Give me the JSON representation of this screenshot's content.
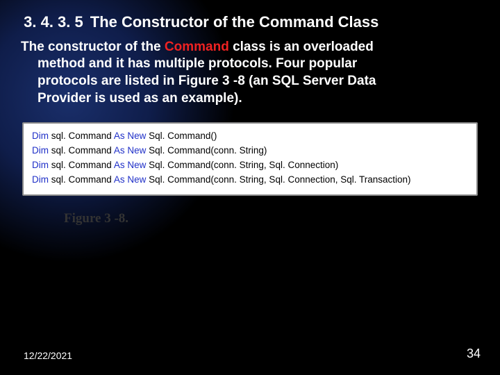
{
  "heading": {
    "number": "3. 4. 3. 5",
    "text": "The Constructor of the Command Class"
  },
  "paragraph": {
    "prefix": "The constructor of the ",
    "command_word": "Command",
    "rest1": " class is an overloaded",
    "rest2": "method and it has multiple protocols. Four popular",
    "rest3": "protocols are listed in Figure 3 -8 (an SQL Server Data",
    "rest4": "Provider is used as an example)."
  },
  "code": {
    "kw_dim": "Dim",
    "kw_asnew": "As New",
    "var": "sql. Command",
    "lines": [
      "Sql. Command()",
      "Sql. Command(conn. String)",
      "Sql. Command(conn. String, Sql. Connection)",
      "Sql. Command(conn. String, Sql. Connection, Sql. Transaction)"
    ]
  },
  "figure_caption": "Figure 3 -8.",
  "footer": {
    "date": "12/22/2021",
    "page": "34"
  }
}
